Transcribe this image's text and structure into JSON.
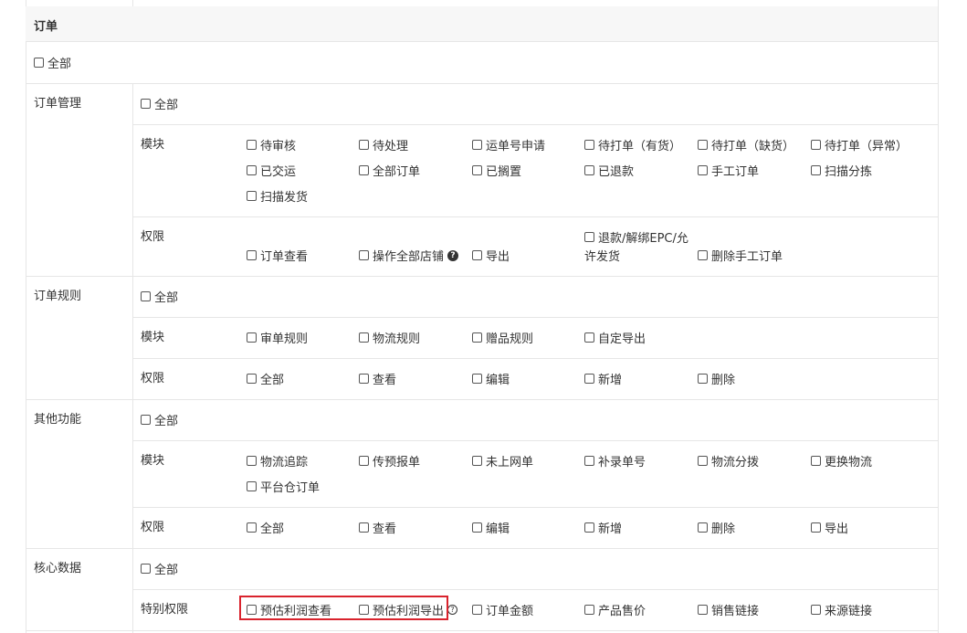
{
  "section": {
    "title": "订单"
  },
  "top_all": "全部",
  "order_mgmt": {
    "label": "订单管理",
    "all": "全部",
    "module_label": "模块",
    "modules": [
      "待审核",
      "待处理",
      "运单号申请",
      "待打单（有货）",
      "待打单（缺货）",
      "待打单（异常）",
      "已交运",
      "全部订单",
      "已搁置",
      "已退款",
      "手工订单",
      "扫描分拣",
      "扫描发货"
    ],
    "perm_label": "权限",
    "perms": [
      "订单查看",
      "操作全部店铺",
      "导出",
      "退款/解绑EPC/允",
      "许发货",
      "删除手工订单"
    ]
  },
  "order_rules": {
    "label": "订单规则",
    "all": "全部",
    "module_label": "模块",
    "modules": [
      "审单规则",
      "物流规则",
      "赠品规则",
      "自定导出"
    ],
    "perm_label": "权限",
    "perms": [
      "全部",
      "查看",
      "编辑",
      "新增",
      "删除"
    ]
  },
  "other": {
    "label": "其他功能",
    "all": "全部",
    "module_label": "模块",
    "modules": [
      "物流追踪",
      "传预报单",
      "未上网单",
      "补录单号",
      "物流分拨",
      "更换物流",
      "平台仓订单"
    ],
    "perm_label": "权限",
    "perms": [
      "全部",
      "查看",
      "编辑",
      "新增",
      "删除",
      "导出"
    ]
  },
  "core": {
    "label": "核心数据",
    "all": "全部",
    "special_label": "特别权限",
    "special": [
      "预估利润查看",
      "预估利润导出",
      "订单金额",
      "产品售价",
      "销售链接",
      "来源链接"
    ]
  },
  "icons": {
    "help": "question-circle-icon",
    "help_outline": "question-circle-outline-icon"
  },
  "colors": {
    "highlight": "#d9232d",
    "border": "#e6e6e6",
    "header_bg": "#f7f7f7"
  }
}
